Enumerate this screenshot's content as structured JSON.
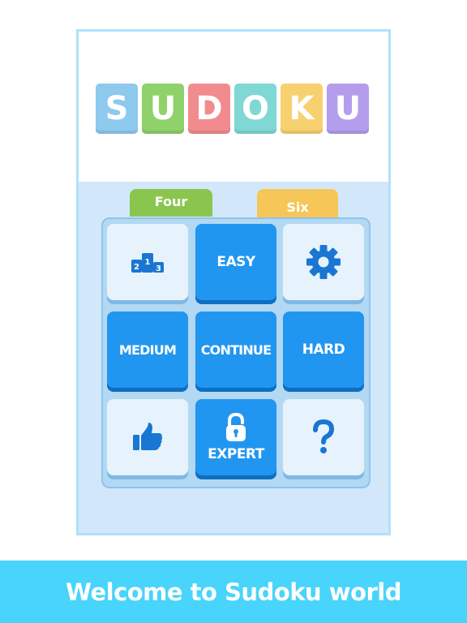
{
  "logo": {
    "letters": [
      {
        "char": "S",
        "color": "#8ec9ee"
      },
      {
        "char": "U",
        "color": "#8fd16a"
      },
      {
        "char": "D",
        "color": "#f28b8d"
      },
      {
        "char": "O",
        "color": "#7fd8d3"
      },
      {
        "char": "K",
        "color": "#f7d06f"
      },
      {
        "char": "U",
        "color": "#b59ded"
      }
    ]
  },
  "tabs": {
    "four_label": "Four",
    "six_label": "Six"
  },
  "grid": {
    "leaderboard_icon": "podium-icon",
    "easy_label": "EASY",
    "settings_icon": "gear-icon",
    "medium_label": "MEDIUM",
    "continue_label": "CONTINUE",
    "hard_label": "HARD",
    "like_icon": "thumbs-up-icon",
    "expert_label": "EXPERT",
    "expert_icon": "lock-icon",
    "help_icon": "question-icon"
  },
  "colors": {
    "button_blue": "#2196f0",
    "button_light": "#e6f3fc",
    "icon_blue": "#1976d2",
    "banner": "#48d4fb"
  },
  "banner": {
    "text": "Welcome to Sudoku world"
  }
}
